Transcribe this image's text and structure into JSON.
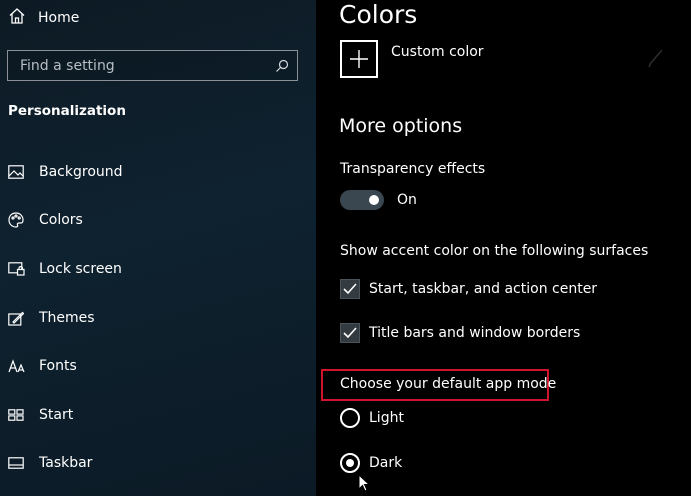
{
  "sidebar": {
    "home_label": "Home",
    "search_placeholder": "Find a setting",
    "section_title": "Personalization",
    "items": [
      {
        "label": "Background",
        "icon": "picture-icon"
      },
      {
        "label": "Colors",
        "icon": "palette-icon"
      },
      {
        "label": "Lock screen",
        "icon": "lock-screen-icon"
      },
      {
        "label": "Themes",
        "icon": "themes-icon"
      },
      {
        "label": "Fonts",
        "icon": "fonts-icon"
      },
      {
        "label": "Start",
        "icon": "start-icon"
      },
      {
        "label": "Taskbar",
        "icon": "taskbar-icon"
      }
    ]
  },
  "main": {
    "title": "Colors",
    "custom_color_label": "Custom color",
    "more_options_title": "More options",
    "transparency": {
      "label": "Transparency effects",
      "state": "On",
      "on": true
    },
    "accent_surfaces": {
      "label": "Show accent color on the following surfaces",
      "options": [
        {
          "label": "Start, taskbar, and action center",
          "checked": true
        },
        {
          "label": "Title bars and window borders",
          "checked": true
        }
      ]
    },
    "app_mode": {
      "label": "Choose your default app mode",
      "options": [
        {
          "label": "Light",
          "selected": false
        },
        {
          "label": "Dark",
          "selected": true
        }
      ]
    }
  },
  "colors": {
    "highlight_box": "#d0142b",
    "sidebar_bg": "#0f2230",
    "main_bg": "#000000"
  }
}
